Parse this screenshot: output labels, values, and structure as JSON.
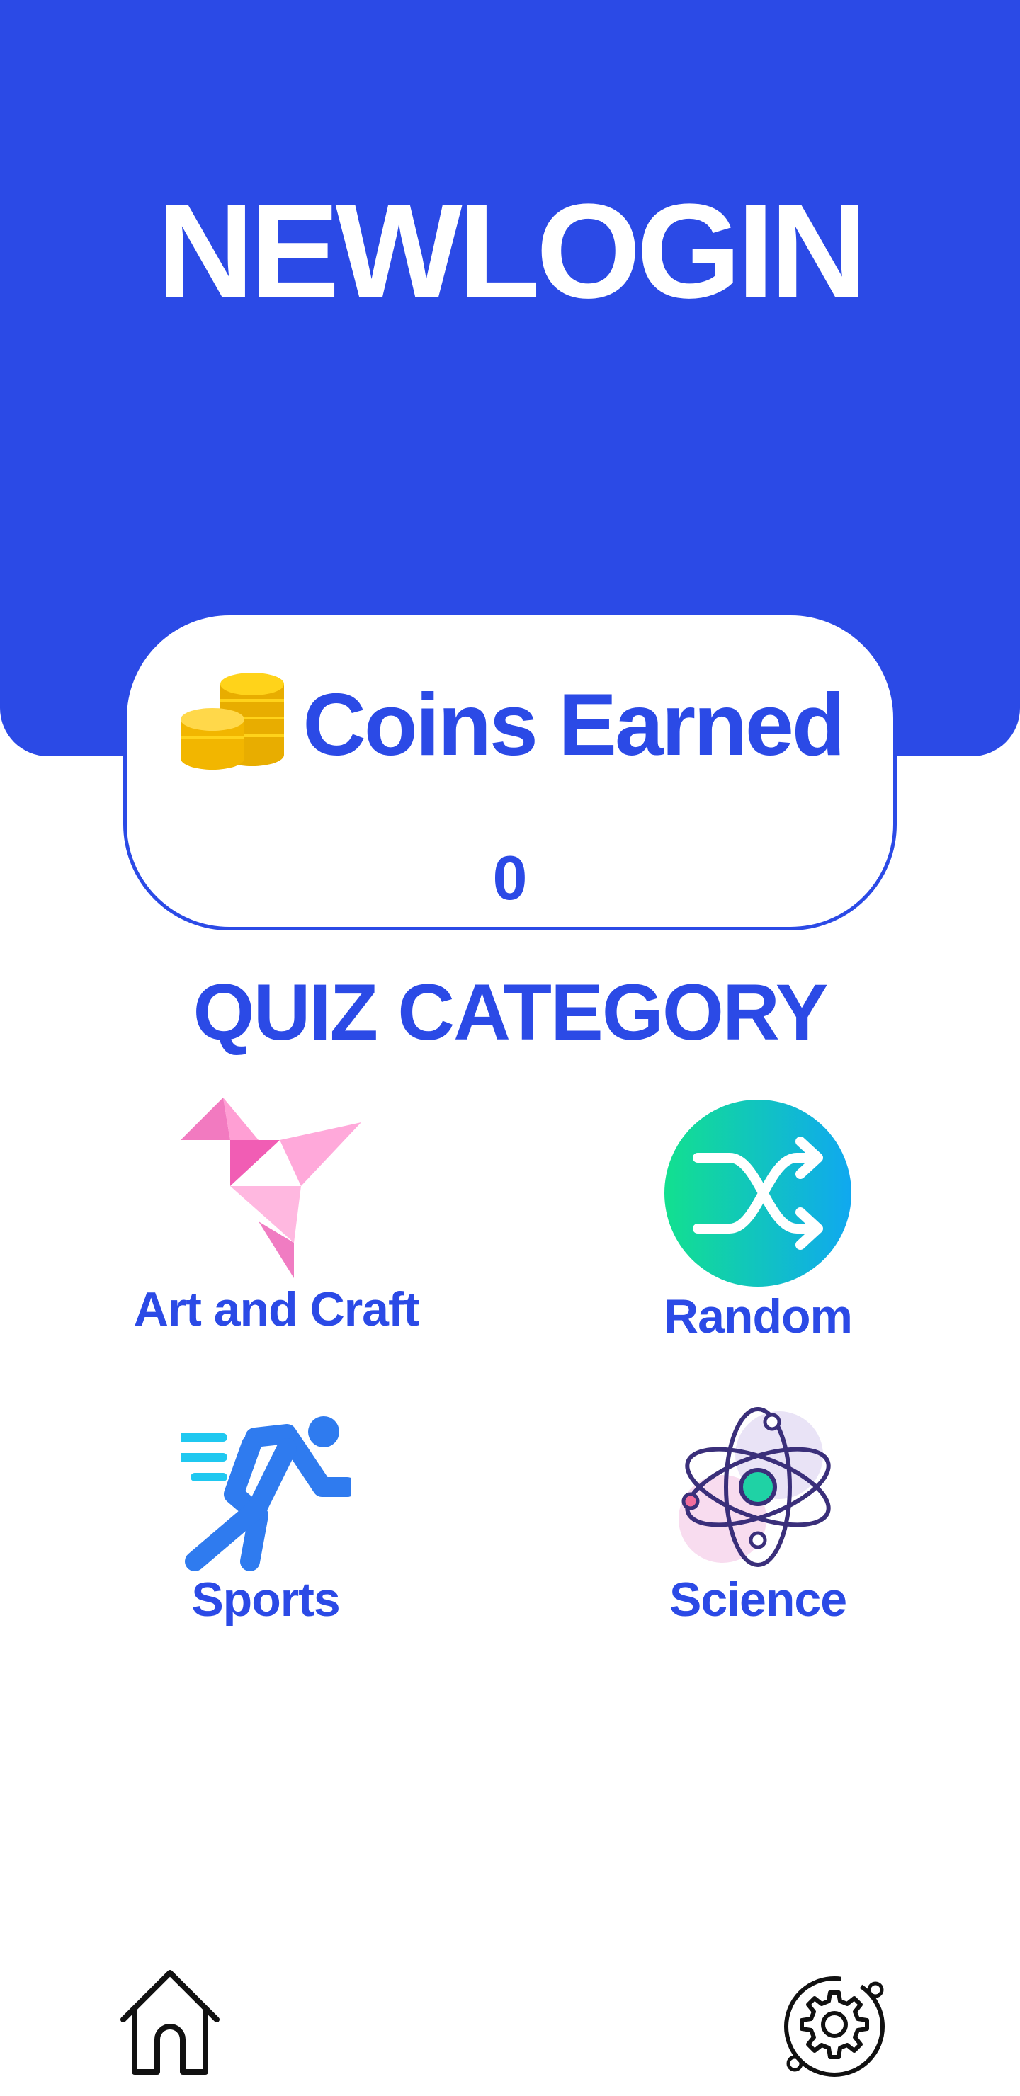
{
  "header": {
    "title": "NEWLOGIN",
    "background_color": "#2b4ae6"
  },
  "coins": {
    "icon": "coins-stack-icon",
    "label": "Coins Earned",
    "value": "0"
  },
  "quiz": {
    "section_title": "QUIZ CATEGORY",
    "categories": [
      {
        "label": "Art and Craft",
        "icon": "origami-bird-icon"
      },
      {
        "label": "Random",
        "icon": "shuffle-icon"
      },
      {
        "label": "Sports",
        "icon": "running-person-icon"
      },
      {
        "label": "Science",
        "icon": "atom-icon"
      }
    ]
  },
  "bottom_nav": {
    "items": [
      {
        "icon": "home-icon"
      },
      {
        "icon": "settings-gear-icon"
      }
    ]
  },
  "colors": {
    "accent": "#2b4ae6",
    "coin_gold": "#f5c400"
  }
}
